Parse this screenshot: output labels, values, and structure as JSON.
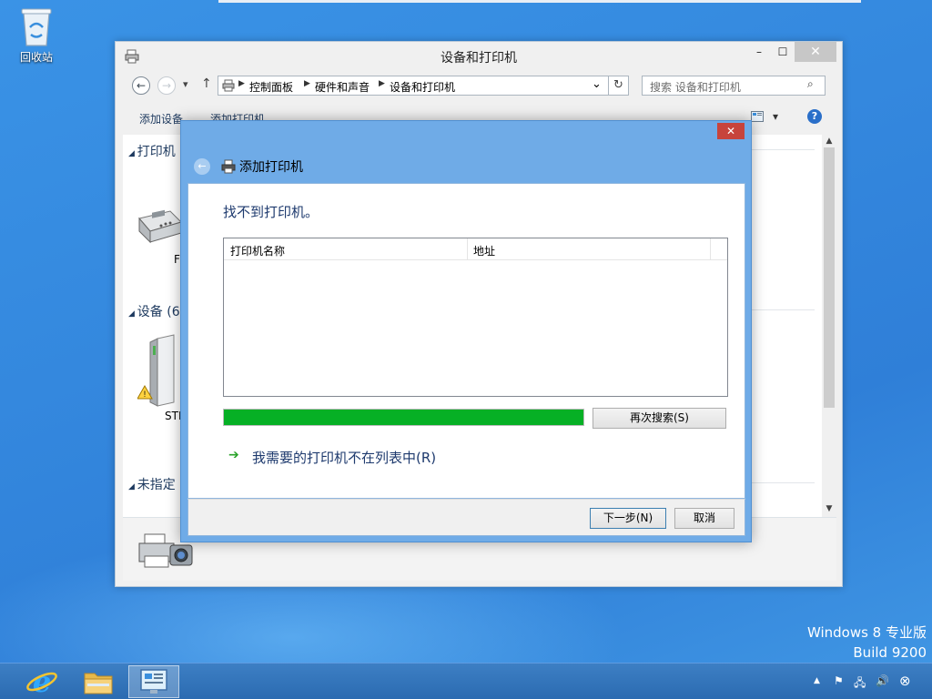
{
  "desktop": {
    "recycle_bin_label": "回收站",
    "watermark_line1": "Windows 8 专业版",
    "watermark_line2": "Build 9200"
  },
  "explorer": {
    "title": "设备和打印机",
    "controls": {
      "minimize": "–",
      "maximize": "☐",
      "close": "✕"
    },
    "nav": {
      "back": "←",
      "forward": "→",
      "recent": "▾",
      "up": "↑"
    },
    "breadcrumb": [
      "控制面板",
      "硬件和声音",
      "设备和打印机"
    ],
    "breadcrumb_sep": "▶",
    "address_dropdown": "⌄",
    "refresh": "↻",
    "search": {
      "placeholder": "搜索 设备和打印机",
      "icon": "⌕"
    },
    "commands": {
      "add_device": "添加设备",
      "add_printer": "添加打印机"
    },
    "view_options_arrow": "▾",
    "help": "?",
    "groups": {
      "printers": "打印机",
      "devices": "设备 (6",
      "unspecified": "未指定"
    },
    "device_labels": {
      "printer_fax": "F",
      "storage": "STF"
    },
    "scroll": {
      "up": "▲",
      "down": "▼"
    }
  },
  "dialog": {
    "title": "添加打印机",
    "close": "✕",
    "back": "←",
    "heading": "找不到打印机。",
    "columns": [
      "打印机名称",
      "地址"
    ],
    "progress_percent": 100,
    "search_again": "再次搜索(S)",
    "link_arrow": "➔",
    "not_listed_link": "我需要的打印机不在列表中(R)",
    "next": "下一步(N)",
    "cancel": "取消"
  },
  "taskbar": {
    "tray": {
      "expand": "▲",
      "flag": "⚑",
      "network": "🖧",
      "volume": "🔊",
      "close": "⊗"
    }
  },
  "colors": {
    "desktop_blue": "#2f7fd8",
    "dialog_frame": "#6fabe7",
    "progress_green": "#06b025",
    "close_red": "#c7443c",
    "link_blue": "#1e3a6e"
  }
}
